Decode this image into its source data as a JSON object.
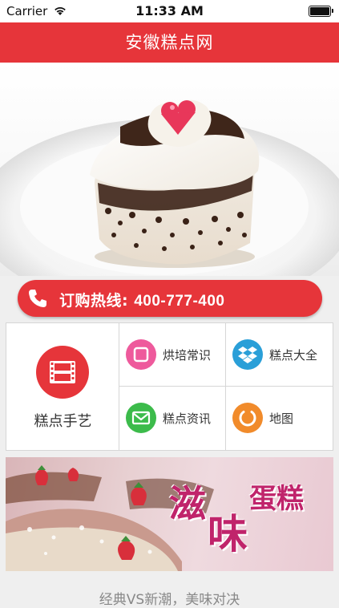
{
  "status": {
    "carrier": "Carrier",
    "time": "11:33 AM"
  },
  "nav": {
    "title": "安徽糕点网"
  },
  "hero": {
    "image": "heart-shaped-cake-photo"
  },
  "hotline": {
    "label": "订购热线: ",
    "number": "400-777-400",
    "icon": "phone-icon"
  },
  "grid": {
    "featured": {
      "label": "糕点手艺",
      "icon": "film-icon",
      "color": "#e6353a"
    },
    "items": [
      {
        "label": "烘培常识",
        "icon": "square-icon",
        "color": "#ee5a9c"
      },
      {
        "label": "糕点大全",
        "icon": "dropbox-icon",
        "color": "#2a9fd8"
      },
      {
        "label": "糕点资讯",
        "icon": "mail-icon",
        "color": "#3cbb4b"
      },
      {
        "label": "地图",
        "icon": "power-icon",
        "color": "#f18b2b"
      }
    ]
  },
  "banner": {
    "title_1": "滋",
    "title_2": "味",
    "title_3": "蛋糕"
  },
  "footer": {
    "tagline": "经典VS新潮，美味对决"
  }
}
